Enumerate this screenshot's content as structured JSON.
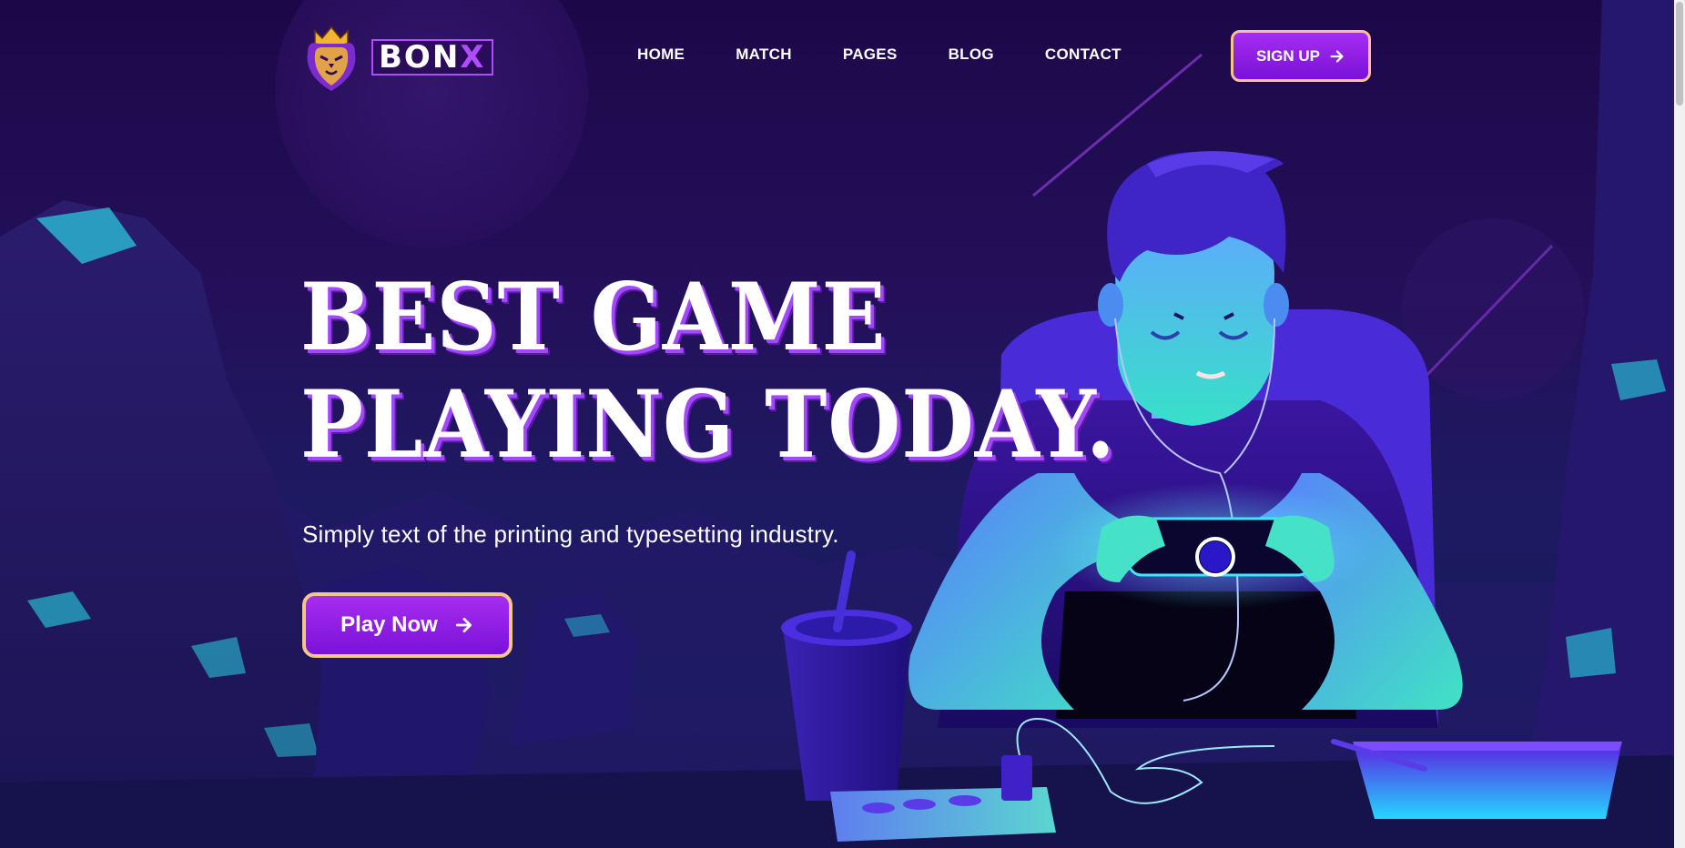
{
  "brand": {
    "wordmark_main": "BON",
    "wordmark_accent": "X",
    "emblem_icon": "crowned-lion-icon"
  },
  "nav": {
    "items": [
      {
        "label": "HOME"
      },
      {
        "label": "MATCH"
      },
      {
        "label": "PAGES"
      },
      {
        "label": "BLOG"
      },
      {
        "label": "CONTACT"
      }
    ]
  },
  "header": {
    "signup_label": "SIGN UP",
    "signup_icon": "arrow-right-icon"
  },
  "hero": {
    "title_line1": "BEST GAME",
    "title_line2": "PLAYING TODAY.",
    "subtitle": "Simply text of the printing and typesetting industry.",
    "cta_label": "Play Now",
    "cta_icon": "arrow-right-icon",
    "illustration": "gamer-playing-phone-illustration"
  },
  "colors": {
    "background": "#1c0848",
    "accent_purple": "#a52df0",
    "button_border": "#f6c58b",
    "title_shadow": "#a347ff"
  }
}
